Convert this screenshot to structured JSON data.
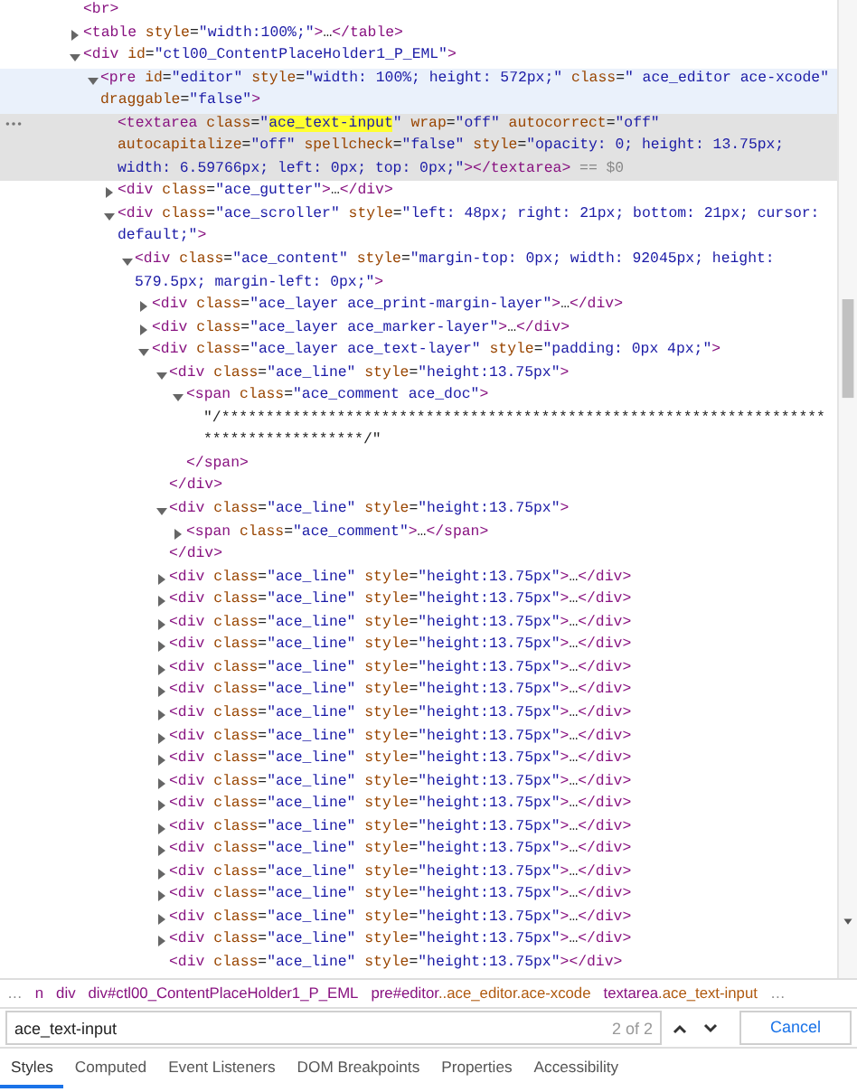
{
  "dom_tree": [
    {
      "kind": "element",
      "text": "<br>",
      "selected": false,
      "hovered": false
    },
    {
      "kind": "element",
      "text": "<table style=\"width:100%;\">…</table>",
      "expanded": false,
      "selected": false,
      "hovered": false
    },
    {
      "kind": "element",
      "text": "<div id=\"ctl00_ContentPlaceHolder1_P_EML\">",
      "expanded": true,
      "selected": false,
      "hovered": false,
      "children": [
        {
          "kind": "element",
          "text": "<pre id=\"editor\" style=\"width: 100%; height: 572px;\" class=\" ace_editor ace-xcode\" draggable=\"false\">",
          "expanded": true,
          "selected": false,
          "hovered": true,
          "children": [
            {
              "kind": "element",
              "text": "<textarea class=\"ace_text-input\" wrap=\"off\" autocorrect=\"off\" autocapitalize=\"off\" spellcheck=\"false\" style=\"opacity: 0; height: 13.75px; width: 6.59766px; left: 0px; top: 0px;\"></textarea>",
              "console_ref": "== $0",
              "selected": true,
              "hovered": false
            },
            {
              "kind": "element",
              "text": "<div class=\"ace_gutter\">…</div>",
              "expanded": false,
              "selected": false,
              "hovered": false
            },
            {
              "kind": "element",
              "text": "<div class=\"ace_scroller\" style=\"left: 48px; right: 21px; bottom: 21px; cursor: default;\">",
              "expanded": true,
              "selected": false,
              "hovered": false,
              "children": [
                {
                  "kind": "element",
                  "text": "<div class=\"ace_content\" style=\"margin-top: 0px; width: 92045px; height: 579.5px; margin-left: 0px;\">",
                  "expanded": true,
                  "selected": false,
                  "hovered": false,
                  "children": [
                    {
                      "kind": "element",
                      "text": "<div class=\"ace_layer ace_print-margin-layer\">…</div>",
                      "expanded": false,
                      "selected": false,
                      "hovered": false
                    },
                    {
                      "kind": "element",
                      "text": "<div class=\"ace_layer ace_marker-layer\">…</div>",
                      "expanded": false,
                      "selected": false,
                      "hovered": false
                    },
                    {
                      "kind": "element",
                      "text": "<div class=\"ace_layer ace_text-layer\" style=\"padding: 0px 4px;\">",
                      "expanded": true,
                      "selected": false,
                      "hovered": false,
                      "children": [
                        {
                          "kind": "element",
                          "text": "<div class=\"ace_line\" style=\"height:13.75px\">",
                          "expanded": true,
                          "selected": false,
                          "hovered": false,
                          "close": "</div>",
                          "children": [
                            {
                              "kind": "element",
                              "text": "<span class=\"ace_comment ace_doc\">",
                              "expanded": true,
                              "selected": false,
                              "hovered": false,
                              "close": "</span>",
                              "children": [
                                {
                                  "kind": "text",
                                  "text": "\"/**************************************************************************************/\"",
                                  "selected": false,
                                  "hovered": false
                                }
                              ]
                            }
                          ]
                        },
                        {
                          "kind": "element",
                          "text": "<div class=\"ace_line\" style=\"height:13.75px\">",
                          "expanded": true,
                          "selected": false,
                          "hovered": false,
                          "close": "</div>",
                          "children": [
                            {
                              "kind": "element",
                              "text": "<span class=\"ace_comment\">…</span>",
                              "expanded": false,
                              "selected": false,
                              "hovered": false
                            }
                          ]
                        },
                        {
                          "kind": "element",
                          "text": "<div class=\"ace_line\" style=\"height:13.75px\">…</div>",
                          "expanded": false,
                          "selected": false,
                          "hovered": false
                        },
                        {
                          "kind": "element",
                          "text": "<div class=\"ace_line\" style=\"height:13.75px\">…</div>",
                          "expanded": false,
                          "selected": false,
                          "hovered": false
                        },
                        {
                          "kind": "element",
                          "text": "<div class=\"ace_line\" style=\"height:13.75px\">…</div>",
                          "expanded": false,
                          "selected": false,
                          "hovered": false
                        },
                        {
                          "kind": "element",
                          "text": "<div class=\"ace_line\" style=\"height:13.75px\">…</div>",
                          "expanded": false,
                          "selected": false,
                          "hovered": false
                        },
                        {
                          "kind": "element",
                          "text": "<div class=\"ace_line\" style=\"height:13.75px\">…</div>",
                          "expanded": false,
                          "selected": false,
                          "hovered": false
                        },
                        {
                          "kind": "element",
                          "text": "<div class=\"ace_line\" style=\"height:13.75px\">…</div>",
                          "expanded": false,
                          "selected": false,
                          "hovered": false
                        },
                        {
                          "kind": "element",
                          "text": "<div class=\"ace_line\" style=\"height:13.75px\">…</div>",
                          "expanded": false,
                          "selected": false,
                          "hovered": false
                        },
                        {
                          "kind": "element",
                          "text": "<div class=\"ace_line\" style=\"height:13.75px\">…</div>",
                          "expanded": false,
                          "selected": false,
                          "hovered": false
                        },
                        {
                          "kind": "element",
                          "text": "<div class=\"ace_line\" style=\"height:13.75px\">…</div>",
                          "expanded": false,
                          "selected": false,
                          "hovered": false
                        },
                        {
                          "kind": "element",
                          "text": "<div class=\"ace_line\" style=\"height:13.75px\">…</div>",
                          "expanded": false,
                          "selected": false,
                          "hovered": false
                        },
                        {
                          "kind": "element",
                          "text": "<div class=\"ace_line\" style=\"height:13.75px\">…</div>",
                          "expanded": false,
                          "selected": false,
                          "hovered": false
                        },
                        {
                          "kind": "element",
                          "text": "<div class=\"ace_line\" style=\"height:13.75px\">…</div>",
                          "expanded": false,
                          "selected": false,
                          "hovered": false
                        },
                        {
                          "kind": "element",
                          "text": "<div class=\"ace_line\" style=\"height:13.75px\">…</div>",
                          "expanded": false,
                          "selected": false,
                          "hovered": false
                        },
                        {
                          "kind": "element",
                          "text": "<div class=\"ace_line\" style=\"height:13.75px\">…</div>",
                          "expanded": false,
                          "selected": false,
                          "hovered": false
                        },
                        {
                          "kind": "element",
                          "text": "<div class=\"ace_line\" style=\"height:13.75px\">…</div>",
                          "expanded": false,
                          "selected": false,
                          "hovered": false
                        },
                        {
                          "kind": "element",
                          "text": "<div class=\"ace_line\" style=\"height:13.75px\">…</div>",
                          "expanded": false,
                          "selected": false,
                          "hovered": false
                        },
                        {
                          "kind": "element",
                          "text": "<div class=\"ace_line\" style=\"height:13.75px\">…</div>",
                          "expanded": false,
                          "selected": false,
                          "hovered": false
                        },
                        {
                          "kind": "element",
                          "text": "<div class=\"ace_line\" style=\"height:13.75px\"></div>",
                          "selected": false,
                          "hovered": false
                        }
                      ]
                    }
                  ]
                }
              ]
            }
          ]
        }
      ]
    }
  ],
  "breadcrumbs": {
    "overflow_left": "…",
    "overflow_right": "…",
    "items": [
      {
        "text": "n"
      },
      {
        "text": "div"
      },
      {
        "text": "div#ctl00_ContentPlaceHolder1_P_EML"
      },
      {
        "text": "pre#editor..ace_editor.ace-xcode"
      },
      {
        "text": "textarea.ace_text-input"
      }
    ]
  },
  "search": {
    "value": "ace_text-input",
    "count": "2 of 2",
    "cancel": "Cancel"
  },
  "tabs": [
    {
      "label": "Styles",
      "selected": true
    },
    {
      "label": "Computed",
      "selected": false
    },
    {
      "label": "Event Listeners",
      "selected": false
    },
    {
      "label": "DOM Breakpoints",
      "selected": false
    },
    {
      "label": "Properties",
      "selected": false
    },
    {
      "label": "Accessibility",
      "selected": false
    }
  ]
}
